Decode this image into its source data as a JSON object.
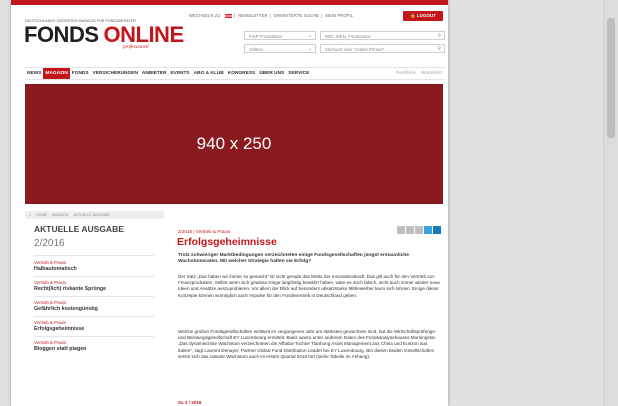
{
  "topnav": {
    "wechseln": "WECHSELN ZU",
    "newsletter": "NEWSLETTER",
    "erweiterte_suche": "ERWEITERTE SUCHE",
    "mein_profil": "MEIN PROFIL",
    "logout": "LOGOUT"
  },
  "header": {
    "tagline": "DEUTSCHLANDS GRÖSSTES MAGAZIN FÜR FONDSBERATER",
    "logo_fonds": "FONDS",
    "logo_online": "ONLINE",
    "logo_sub": "professionell",
    "select_fondsdaten": "FIAP Fondsdaten",
    "search_isin": "ISIN, WKN, Fondsname",
    "select_volltext": "Volltext",
    "search_stichwort": "Stichwort oder \"exakte Phrase\""
  },
  "mainnav": {
    "items": [
      "NEWS",
      "MAGAZIN",
      "FONDS",
      "VERSICHERUNGEN",
      "ANBIETER",
      "EVENTS",
      "ABO & KLUB",
      "KONGRESS",
      "ÜBER UNS",
      "SERVICE"
    ],
    "portfolio": "Portfolio",
    "watchlist": "Watchlist"
  },
  "banner": {
    "label": "940 x 250"
  },
  "breadcrumb": [
    "HOME",
    "MAGAZIN",
    "AKTUELLE AUSGABE"
  ],
  "sidebar": {
    "heading": "AKTUELLE AUSGABE",
    "issue": "2/2016",
    "items": [
      {
        "category": "Vertrieb & Praxis",
        "title": "Halbautomatisch"
      },
      {
        "category": "Vertrieb & Praxis",
        "title": "Recht(lich) riskante Sprünge"
      },
      {
        "category": "Vertrieb & Praxis",
        "title": "Gefährlich kostengünstig"
      },
      {
        "category": "Vertrieb & Praxis",
        "title": "Erfolgsgeheimnisse"
      },
      {
        "category": "Vertrieb & Praxis",
        "title": "Bloggen statt plagen"
      }
    ]
  },
  "article": {
    "meta": "2/2016 | Vertrieb & Praxis",
    "title": "Erfolgsgeheimnisse",
    "lead": "Trotz schwieriger Marktbedingungen verzeichneten einige Fondsgesellschaften jüngst erstaunliche Wachstumsraten. Mit welcher Strategie halten sie Erfolg?",
    "para1": "Der Satz „Das haben wir immer so gemacht\" ist nicht gerade das Motto der Innovationskraft. Das gilt auch für den Vertrieb von Finanzprodukten. Selbst wenn sich gewisse Dinge langfristig bewährt haben, wäre es doch falsch, nicht auch immer wieder neue Ideen und Ansätze auszuprobieren. Vor allem der Blick auf besonders absatzstarke Mitbewerber kann sich lohnen. Einige dieser Konzepte können womöglich auch Impulse für den Fondsvertrieb in Deutschland geben.",
    "para2": "Welche großen Fondsgesellschaften weltweit im vergangenen Jahr am stärksten gewachsen sind, hat die Wirtschaftsprüfungs- und Beratungsgesellschaft EY Luxembourg ermittelt. Basis waren unter anderem Daten des Fondsanalysehauses Morningstar. „Das dynamischste Wachstum verzeichneten die Allbaba-Tochter Tianhong Asset Management aus China und Eurizon aus Italien\", sagt Laurent Denayer, Partner Global Fund Distribution Leader bei EY Luxembourg. Bei diesen beiden Gesellschaften setzte sich das rasante Wachstum auch im ersten Quartal 2016 fort (siehe Tabelle im Anhang).",
    "more": "Zu 2 / 2016"
  }
}
